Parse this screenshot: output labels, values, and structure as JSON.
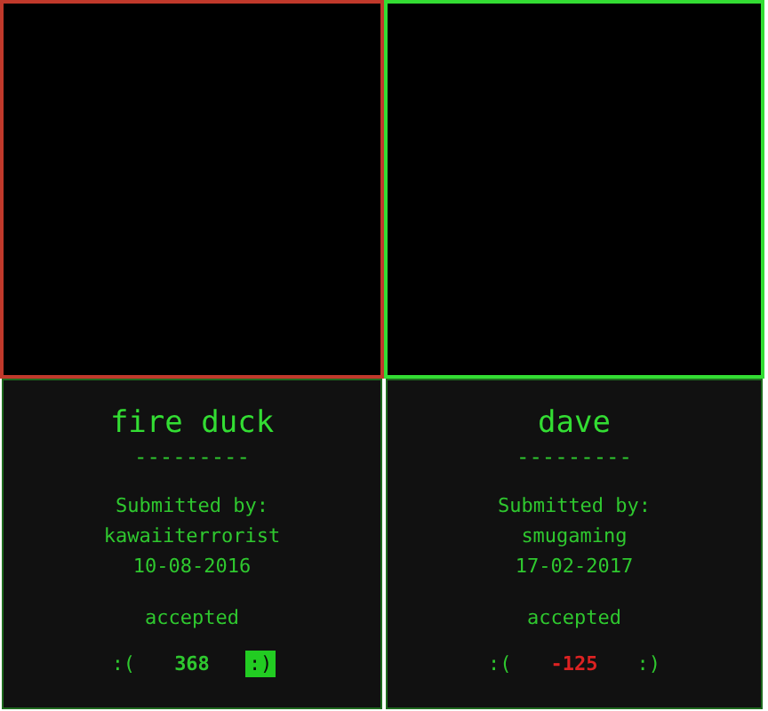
{
  "cards": [
    {
      "color": "#c0392b",
      "title": "fire duck",
      "rule": "---------",
      "submitted_label": "Submitted by:",
      "author": "kawaiiterrorist",
      "date": "10-08-2016",
      "status": "accepted",
      "downvote": ":(",
      "score": "368",
      "negative": false,
      "upvote": ":)",
      "upvoted": true
    },
    {
      "color": "#33dd33",
      "title": "dave",
      "rule": "---------",
      "submitted_label": "Submitted by:",
      "author": "smugaming",
      "date": "17-02-2017",
      "status": "accepted",
      "downvote": ":(",
      "score": "-125",
      "negative": true,
      "upvote": ":)",
      "upvoted": false
    }
  ]
}
